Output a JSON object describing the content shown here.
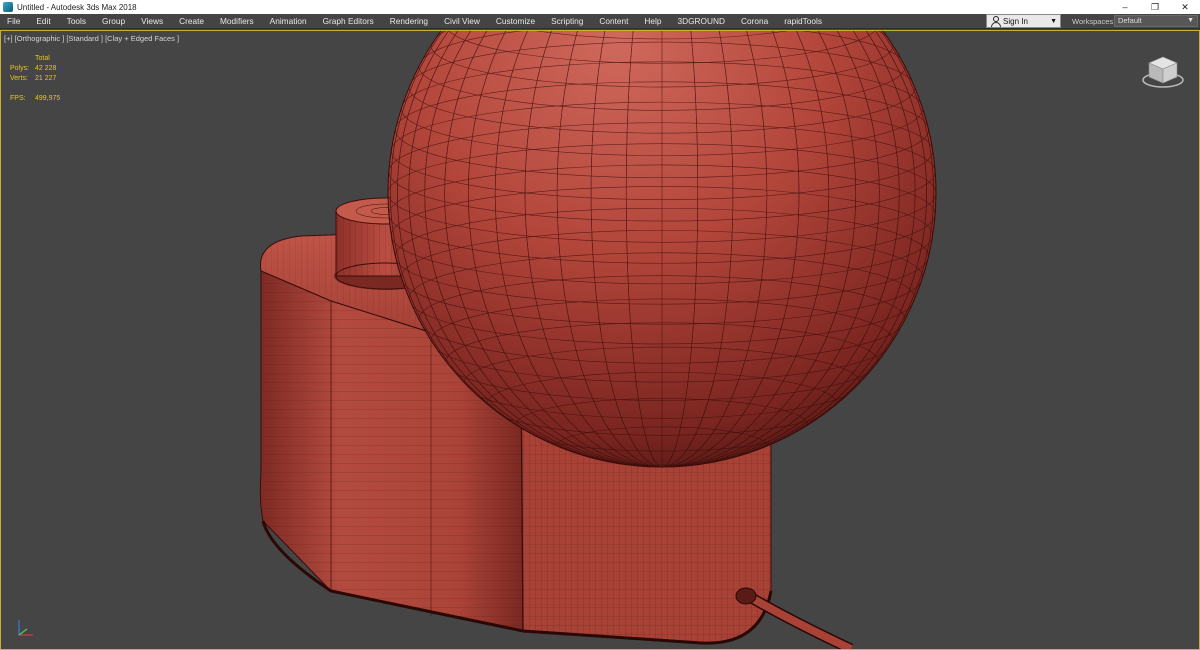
{
  "window": {
    "title": "Untitled - Autodesk 3ds Max 2018",
    "controls": [
      "minimize-icon",
      "restore-icon",
      "close-icon"
    ]
  },
  "menu": {
    "items": [
      "File",
      "Edit",
      "Tools",
      "Group",
      "Views",
      "Create",
      "Modifiers",
      "Animation",
      "Graph Editors",
      "Rendering",
      "Civil View",
      "Customize",
      "Scripting",
      "Content",
      "Help",
      "3DGROUND",
      "Corona",
      "rapidTools"
    ],
    "sign_in": "Sign In",
    "workspaces_label": "Workspaces:",
    "workspace_value": "Default"
  },
  "viewport": {
    "label": "[+] [Orthographic ] [Standard ] [Clay + Edged Faces ]",
    "stats": {
      "header": "Total",
      "polys_label": "Polys:",
      "polys_value": "42 228",
      "verts_label": "Verts:",
      "verts_value": "21 227",
      "fps_label": "FPS:",
      "fps_value": "499,975"
    }
  },
  "colors": {
    "accent": "#c8b030",
    "clay": "#b8453a",
    "viewport_bg": "#454545",
    "stats_text": "#e6c52b"
  },
  "icons": [
    "app-icon",
    "user-icon",
    "chevron-down-icon",
    "viewcube-icon",
    "axis-tripod-icon"
  ]
}
